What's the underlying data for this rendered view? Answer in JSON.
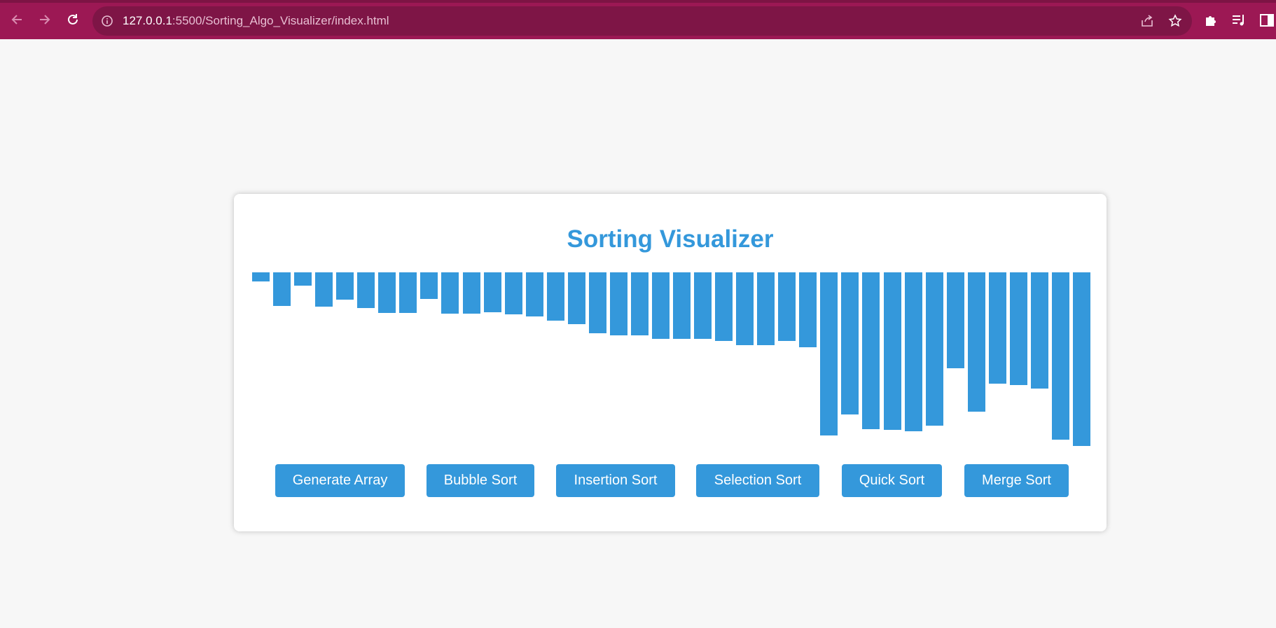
{
  "browser": {
    "url_host": "127.0.0.1",
    "url_path": ":5500/Sorting_Algo_Visualizer/index.html"
  },
  "app": {
    "title": "Sorting Visualizer",
    "bar_color": "#3498db"
  },
  "array_values": [
    13,
    48,
    19,
    49,
    39,
    51,
    58,
    58,
    38,
    59,
    59,
    57,
    60,
    63,
    69,
    74,
    87,
    90,
    90,
    95,
    95,
    95,
    98,
    104,
    104,
    98,
    107,
    233,
    203,
    224,
    225,
    227,
    219,
    137,
    199,
    159,
    161,
    166,
    239,
    248
  ],
  "buttons": [
    {
      "id": "generate",
      "label": "Generate Array"
    },
    {
      "id": "bubble",
      "label": "Bubble Sort"
    },
    {
      "id": "insertion",
      "label": "Insertion Sort"
    },
    {
      "id": "selection",
      "label": "Selection Sort"
    },
    {
      "id": "quick",
      "label": "Quick Sort"
    },
    {
      "id": "merge",
      "label": "Merge Sort"
    }
  ]
}
